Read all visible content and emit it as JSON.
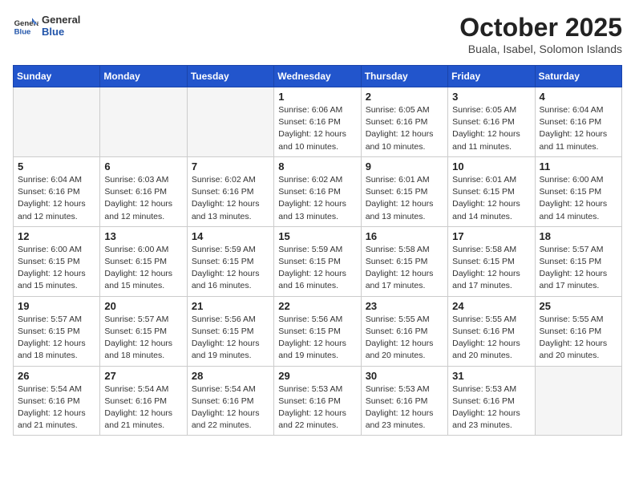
{
  "header": {
    "logo_general": "General",
    "logo_blue": "Blue",
    "month_title": "October 2025",
    "subtitle": "Buala, Isabel, Solomon Islands"
  },
  "weekdays": [
    "Sunday",
    "Monday",
    "Tuesday",
    "Wednesday",
    "Thursday",
    "Friday",
    "Saturday"
  ],
  "weeks": [
    [
      {
        "day": "",
        "info": ""
      },
      {
        "day": "",
        "info": ""
      },
      {
        "day": "",
        "info": ""
      },
      {
        "day": "1",
        "info": "Sunrise: 6:06 AM\nSunset: 6:16 PM\nDaylight: 12 hours\nand 10 minutes."
      },
      {
        "day": "2",
        "info": "Sunrise: 6:05 AM\nSunset: 6:16 PM\nDaylight: 12 hours\nand 10 minutes."
      },
      {
        "day": "3",
        "info": "Sunrise: 6:05 AM\nSunset: 6:16 PM\nDaylight: 12 hours\nand 11 minutes."
      },
      {
        "day": "4",
        "info": "Sunrise: 6:04 AM\nSunset: 6:16 PM\nDaylight: 12 hours\nand 11 minutes."
      }
    ],
    [
      {
        "day": "5",
        "info": "Sunrise: 6:04 AM\nSunset: 6:16 PM\nDaylight: 12 hours\nand 12 minutes."
      },
      {
        "day": "6",
        "info": "Sunrise: 6:03 AM\nSunset: 6:16 PM\nDaylight: 12 hours\nand 12 minutes."
      },
      {
        "day": "7",
        "info": "Sunrise: 6:02 AM\nSunset: 6:16 PM\nDaylight: 12 hours\nand 13 minutes."
      },
      {
        "day": "8",
        "info": "Sunrise: 6:02 AM\nSunset: 6:16 PM\nDaylight: 12 hours\nand 13 minutes."
      },
      {
        "day": "9",
        "info": "Sunrise: 6:01 AM\nSunset: 6:15 PM\nDaylight: 12 hours\nand 13 minutes."
      },
      {
        "day": "10",
        "info": "Sunrise: 6:01 AM\nSunset: 6:15 PM\nDaylight: 12 hours\nand 14 minutes."
      },
      {
        "day": "11",
        "info": "Sunrise: 6:00 AM\nSunset: 6:15 PM\nDaylight: 12 hours\nand 14 minutes."
      }
    ],
    [
      {
        "day": "12",
        "info": "Sunrise: 6:00 AM\nSunset: 6:15 PM\nDaylight: 12 hours\nand 15 minutes."
      },
      {
        "day": "13",
        "info": "Sunrise: 6:00 AM\nSunset: 6:15 PM\nDaylight: 12 hours\nand 15 minutes."
      },
      {
        "day": "14",
        "info": "Sunrise: 5:59 AM\nSunset: 6:15 PM\nDaylight: 12 hours\nand 16 minutes."
      },
      {
        "day": "15",
        "info": "Sunrise: 5:59 AM\nSunset: 6:15 PM\nDaylight: 12 hours\nand 16 minutes."
      },
      {
        "day": "16",
        "info": "Sunrise: 5:58 AM\nSunset: 6:15 PM\nDaylight: 12 hours\nand 17 minutes."
      },
      {
        "day": "17",
        "info": "Sunrise: 5:58 AM\nSunset: 6:15 PM\nDaylight: 12 hours\nand 17 minutes."
      },
      {
        "day": "18",
        "info": "Sunrise: 5:57 AM\nSunset: 6:15 PM\nDaylight: 12 hours\nand 17 minutes."
      }
    ],
    [
      {
        "day": "19",
        "info": "Sunrise: 5:57 AM\nSunset: 6:15 PM\nDaylight: 12 hours\nand 18 minutes."
      },
      {
        "day": "20",
        "info": "Sunrise: 5:57 AM\nSunset: 6:15 PM\nDaylight: 12 hours\nand 18 minutes."
      },
      {
        "day": "21",
        "info": "Sunrise: 5:56 AM\nSunset: 6:15 PM\nDaylight: 12 hours\nand 19 minutes."
      },
      {
        "day": "22",
        "info": "Sunrise: 5:56 AM\nSunset: 6:15 PM\nDaylight: 12 hours\nand 19 minutes."
      },
      {
        "day": "23",
        "info": "Sunrise: 5:55 AM\nSunset: 6:16 PM\nDaylight: 12 hours\nand 20 minutes."
      },
      {
        "day": "24",
        "info": "Sunrise: 5:55 AM\nSunset: 6:16 PM\nDaylight: 12 hours\nand 20 minutes."
      },
      {
        "day": "25",
        "info": "Sunrise: 5:55 AM\nSunset: 6:16 PM\nDaylight: 12 hours\nand 20 minutes."
      }
    ],
    [
      {
        "day": "26",
        "info": "Sunrise: 5:54 AM\nSunset: 6:16 PM\nDaylight: 12 hours\nand 21 minutes."
      },
      {
        "day": "27",
        "info": "Sunrise: 5:54 AM\nSunset: 6:16 PM\nDaylight: 12 hours\nand 21 minutes."
      },
      {
        "day": "28",
        "info": "Sunrise: 5:54 AM\nSunset: 6:16 PM\nDaylight: 12 hours\nand 22 minutes."
      },
      {
        "day": "29",
        "info": "Sunrise: 5:53 AM\nSunset: 6:16 PM\nDaylight: 12 hours\nand 22 minutes."
      },
      {
        "day": "30",
        "info": "Sunrise: 5:53 AM\nSunset: 6:16 PM\nDaylight: 12 hours\nand 23 minutes."
      },
      {
        "day": "31",
        "info": "Sunrise: 5:53 AM\nSunset: 6:16 PM\nDaylight: 12 hours\nand 23 minutes."
      },
      {
        "day": "",
        "info": ""
      }
    ]
  ]
}
